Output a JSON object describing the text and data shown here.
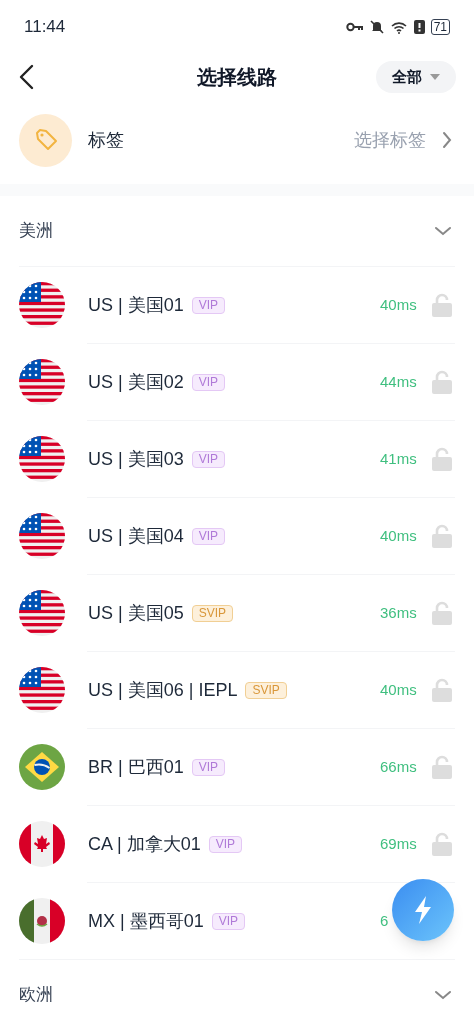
{
  "status_bar": {
    "time": "11:44",
    "battery": "71"
  },
  "header": {
    "title": "选择线路",
    "filter": "全部"
  },
  "tag_row": {
    "label": "标签",
    "hint": "选择标签"
  },
  "sections": [
    {
      "title": "美洲",
      "servers": [
        {
          "name": "US | 美国01",
          "tier": "VIP",
          "kind": "us",
          "latency": "40ms",
          "locked": true
        },
        {
          "name": "US | 美国02",
          "tier": "VIP",
          "kind": "us",
          "latency": "44ms",
          "locked": true
        },
        {
          "name": "US | 美国03",
          "tier": "VIP",
          "kind": "us",
          "latency": "41ms",
          "locked": true
        },
        {
          "name": "US | 美国04",
          "tier": "VIP",
          "kind": "us",
          "latency": "40ms",
          "locked": true
        },
        {
          "name": "US | 美国05",
          "tier": "SVIP",
          "kind": "us",
          "latency": "36ms",
          "locked": true
        },
        {
          "name": "US | 美国06 | IEPL",
          "tier": "SVIP",
          "kind": "us",
          "latency": "40ms",
          "locked": true
        },
        {
          "name": "BR | 巴西01",
          "tier": "VIP",
          "kind": "br",
          "latency": "66ms",
          "locked": true
        },
        {
          "name": "CA | 加拿大01",
          "tier": "VIP",
          "kind": "ca",
          "latency": "69ms",
          "locked": true
        },
        {
          "name": "MX | 墨西哥01",
          "tier": "VIP",
          "kind": "mx",
          "latency": "6"
        }
      ]
    },
    {
      "title": "欧洲"
    }
  ]
}
